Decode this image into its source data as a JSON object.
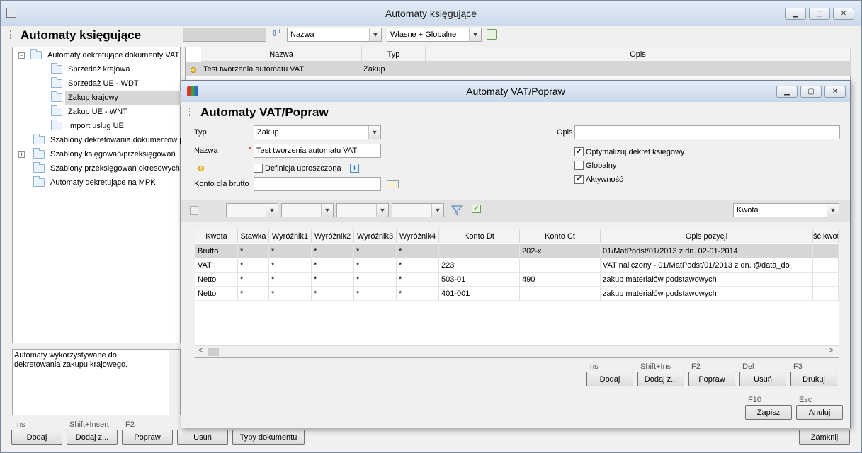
{
  "main": {
    "window_title": "Automaty księgujące",
    "header": "Automaty księgujące",
    "search_value": "",
    "sort_field": "Nazwa",
    "scope_filter": "Własne + Globalne",
    "tree": [
      {
        "label": "Automaty dekretujące dokumenty VAT",
        "expander": "−"
      },
      {
        "label": "Sprzedaż krajowa"
      },
      {
        "label": "Sprzedaż UE - WDT"
      },
      {
        "label": "Zakup krajowy"
      },
      {
        "label": "Zakup UE - WNT"
      },
      {
        "label": "Import usług UE"
      },
      {
        "label": "Szablony dekretowania dokumentów p"
      },
      {
        "label": "Szablony księgowań/przeksięgowań",
        "expander": "+"
      },
      {
        "label": "Szablony przeksięgowań okresowych"
      },
      {
        "label": "Automaty dekretujące na MPK"
      }
    ],
    "description": "Automaty wykorzystywane do dekretowania zakupu krajowego.",
    "list_columns": [
      "Nazwa",
      "Typ",
      "Opis"
    ],
    "list_rows": [
      {
        "nazwa": "Test tworzenia automatu VAT",
        "typ": "Zakup",
        "opis": ""
      }
    ],
    "buttons": {
      "add_key": "Ins",
      "add": "Dodaj",
      "add_copy_key": "Shift+Insert",
      "add_copy": "Dodaj z...",
      "edit_key": "F2",
      "edit": "Popraw",
      "delete": "Usuń",
      "doc_types": "Typy dokumentu",
      "close": "Zamknij"
    }
  },
  "dialog": {
    "window_title": "Automaty VAT/Popraw",
    "header": "Automaty VAT/Popraw",
    "typ_label": "Typ",
    "typ_value": "Zakup",
    "nazwa_label": "Nazwa",
    "nazwa_value": "Test tworzenia automatu VAT",
    "required_mark": "*",
    "simplified_label": "Definicja uproszczona",
    "konto_label": "Konto dla brutto",
    "konto_value": "",
    "opis_label": "Opis",
    "opis_value": "",
    "chk_optimize": "Optymalizuj dekret księgowy",
    "chk_optimize_state": "✔",
    "chk_global": "Globalny",
    "chk_global_state": "",
    "chk_active": "Aktywność",
    "chk_active_state": "✔",
    "filters": [
      "",
      "",
      "",
      ""
    ],
    "amount_select": "Kwota",
    "grid_columns": [
      "Kwota",
      "Stawka",
      "Wyróżnik1",
      "Wyróżnik2",
      "Wyróżnik3",
      "Wyróżnik4",
      "Konto Dt",
      "Konto Ct",
      "Opis pozycji",
      "ść kwoty"
    ],
    "grid_rows": [
      {
        "kwota": "Brutto",
        "stawka": "*",
        "w1": "*",
        "w2": "*",
        "w3": "*",
        "w4": "*",
        "dt": "",
        "ct": "202-x",
        "opis": "01/MatPodst/01/2013 z dn. 02-01-2014"
      },
      {
        "kwota": "VAT",
        "stawka": "*",
        "w1": "*",
        "w2": "*",
        "w3": "*",
        "w4": "*",
        "dt": "223",
        "ct": "",
        "opis": "VAT naliczony - 01/MatPodst/01/2013 z dn. @data_do"
      },
      {
        "kwota": "Netto",
        "stawka": "*",
        "w1": "*",
        "w2": "*",
        "w3": "*",
        "w4": "*",
        "dt": "503-01",
        "ct": "490",
        "opis": "zakup materiałów podstawowych"
      },
      {
        "kwota": "Netto",
        "stawka": "*",
        "w1": "*",
        "w2": "*",
        "w3": "*",
        "w4": "*",
        "dt": "401-001",
        "ct": "",
        "opis": "zakup materiałów podstawowych"
      }
    ],
    "buttons": {
      "add_key": "Ins",
      "add": "Dodaj",
      "add_copy_key": "Shift+Ins",
      "add_copy": "Dodaj z...",
      "edit_key": "F2",
      "edit": "Popraw",
      "del_key": "Del",
      "delete": "Usuń",
      "print_key": "F3",
      "print": "Drukuj",
      "save_key": "F10",
      "save": "Zapisz",
      "cancel_key": "Esc",
      "cancel": "Anuluj"
    }
  }
}
